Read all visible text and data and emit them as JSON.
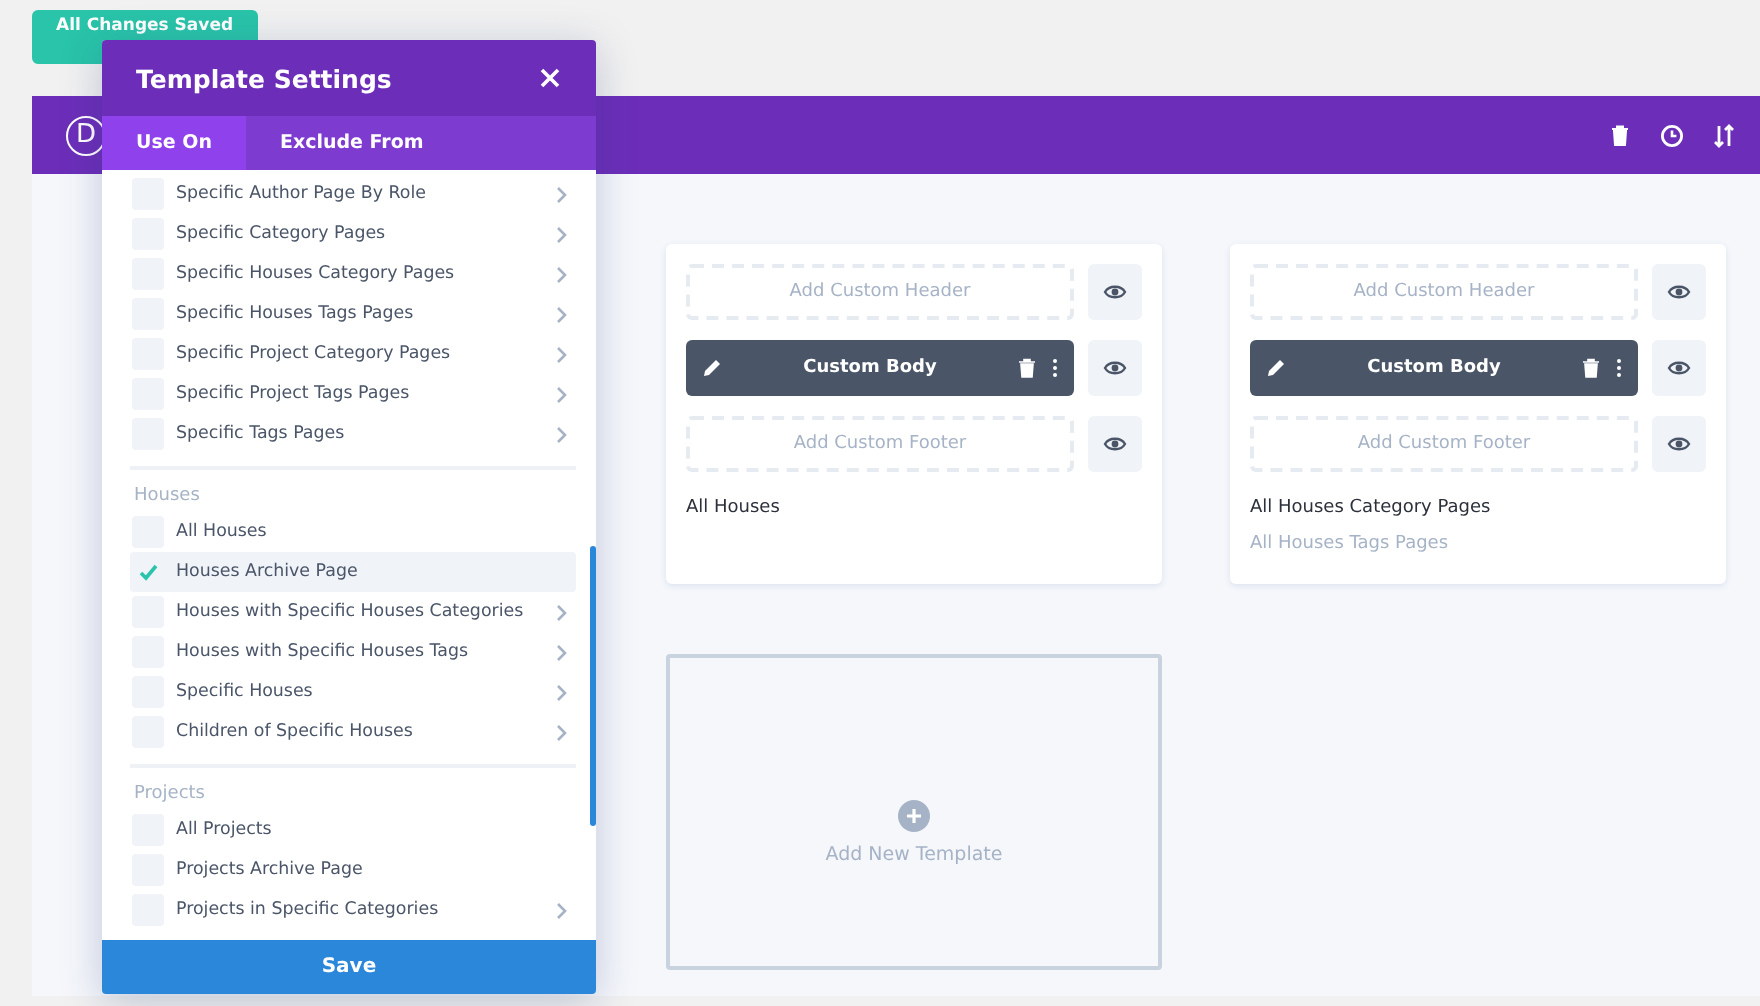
{
  "save_status": "All Changes Saved",
  "toolbar": {
    "logo": "D"
  },
  "templates": [
    {
      "header": "Add Custom Header",
      "body": "Custom Body",
      "footer": "Add Custom Footer",
      "assignments": [
        {
          "label": "All Houses",
          "muted": false
        }
      ]
    },
    {
      "header": "Add Custom Header",
      "body": "Custom Body",
      "footer": "Add Custom Footer",
      "assignments": [
        {
          "label": "All Houses Category Pages",
          "muted": false
        },
        {
          "label": "All Houses Tags Pages",
          "muted": true
        }
      ]
    }
  ],
  "add_template": "Add New Template",
  "modal": {
    "title": "Template Settings",
    "tabs": [
      {
        "label": "Use On",
        "selected": true
      },
      {
        "label": "Exclude From",
        "selected": false
      }
    ],
    "groups": [
      {
        "items": [
          {
            "label": "Specific Author Page By Role",
            "checked": false,
            "expandable": true
          },
          {
            "label": "Specific Category Pages",
            "checked": false,
            "expandable": true
          },
          {
            "label": "Specific Houses Category Pages",
            "checked": false,
            "expandable": true
          },
          {
            "label": "Specific Houses Tags Pages",
            "checked": false,
            "expandable": true
          },
          {
            "label": "Specific Project Category Pages",
            "checked": false,
            "expandable": true
          },
          {
            "label": "Specific Project Tags Pages",
            "checked": false,
            "expandable": true
          },
          {
            "label": "Specific Tags Pages",
            "checked": false,
            "expandable": true
          }
        ]
      },
      {
        "heading": "Houses",
        "items": [
          {
            "label": "All Houses",
            "checked": false,
            "expandable": false
          },
          {
            "label": "Houses Archive Page",
            "checked": true,
            "expandable": false
          },
          {
            "label": "Houses with Specific Houses Categories",
            "checked": false,
            "expandable": true
          },
          {
            "label": "Houses with Specific Houses Tags",
            "checked": false,
            "expandable": true
          },
          {
            "label": "Specific Houses",
            "checked": false,
            "expandable": true
          },
          {
            "label": "Children of Specific Houses",
            "checked": false,
            "expandable": true
          }
        ]
      },
      {
        "heading": "Projects",
        "items": [
          {
            "label": "All Projects",
            "checked": false,
            "expandable": false
          },
          {
            "label": "Projects Archive Page",
            "checked": false,
            "expandable": false
          },
          {
            "label": "Projects in Specific Categories",
            "checked": false,
            "expandable": true
          }
        ]
      }
    ],
    "save": "Save"
  }
}
